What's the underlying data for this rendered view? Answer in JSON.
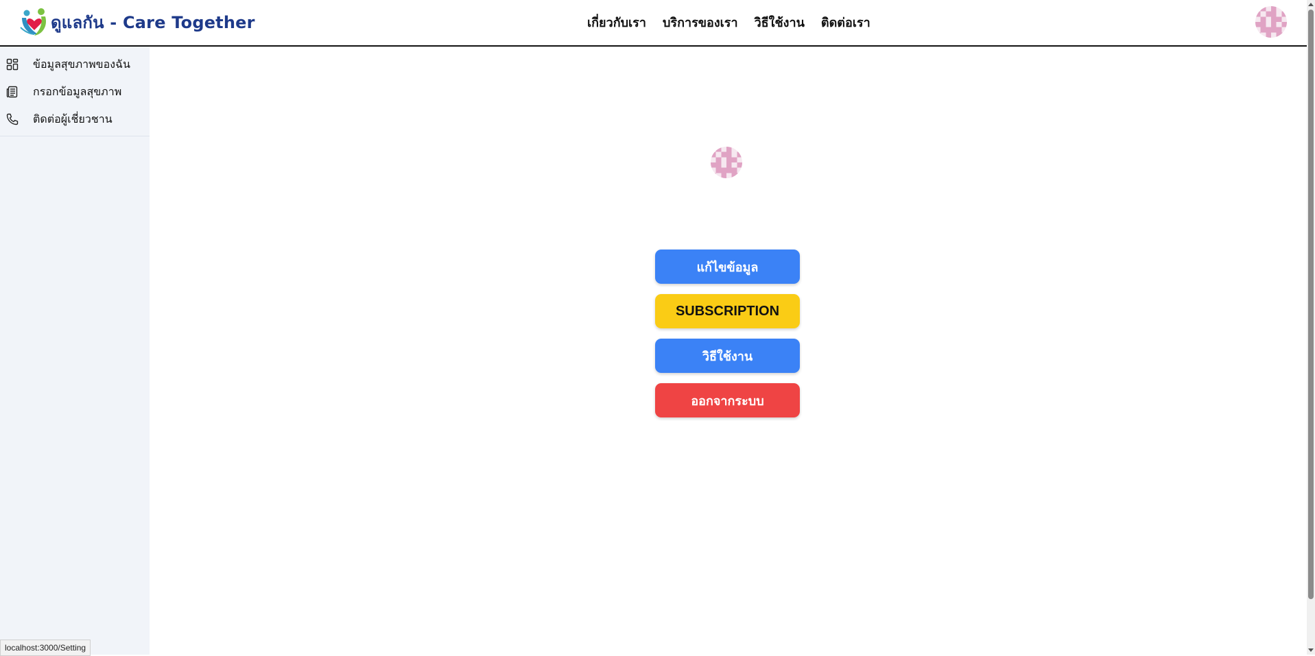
{
  "header": {
    "brand_text": "ดูแลกัน - Care Together",
    "nav": [
      "เกี่ยวกับเรา",
      "บริการของเรา",
      "วิธีใช้งาน",
      "ติดต่อเรา"
    ]
  },
  "sidebar": {
    "items": [
      {
        "label": "ข้อมูลสุขภาพของฉัน",
        "icon": "dashboard-icon"
      },
      {
        "label": "กรอกข้อมูลสุขภาพ",
        "icon": "newspaper-icon"
      },
      {
        "label": "ติดต่อผู้เชี่ยวชาน",
        "icon": "phone-icon"
      }
    ]
  },
  "main": {
    "buttons": {
      "edit": "แก้ไขข้อมูล",
      "subscription": "SUBSCRIPTION",
      "how_to": "วิธีใช้งาน",
      "logout": "ออกจากระบบ"
    }
  },
  "status_bar": {
    "url": "localhost:3000/Setting"
  },
  "colors": {
    "brand": "#1e3a8a",
    "primary": "#3b82f6",
    "warning": "#facc15",
    "danger": "#ef4444",
    "sidebar_bg": "#f1f4f9",
    "avatar_pink": "#e0a3c4"
  }
}
